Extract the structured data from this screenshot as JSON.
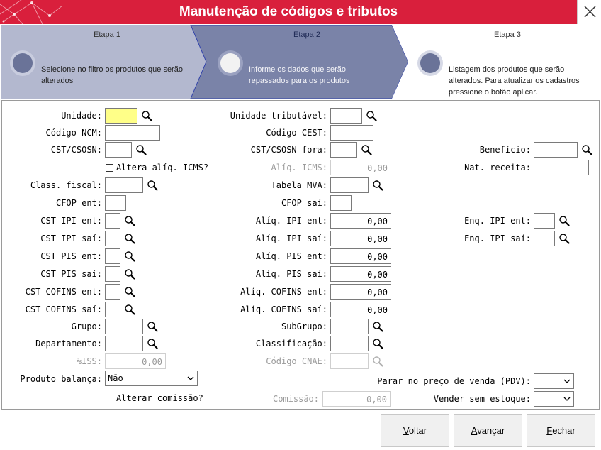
{
  "window": {
    "title": "Manutenção de códigos e tributos"
  },
  "wizard": {
    "steps": [
      {
        "label": "Etapa 1",
        "description": "Selecione no filtro os produtos que serão alterados"
      },
      {
        "label": "Etapa 2",
        "description": "Informe os dados que serão repassados para os produtos"
      },
      {
        "label": "Etapa 3",
        "description": "Listagem dos produtos que serão alterados. Para atualizar os cadastros pressione o botão aplicar."
      }
    ]
  },
  "form": {
    "unidade": "Unidade:",
    "codigo_ncm": "Código NCM:",
    "cst_csosn": "CST/CSOSN:",
    "altera_aliq_icms": "Altera alíq. ICMS?",
    "class_fiscal": "Class. fiscal:",
    "cfop_ent": "CFOP ent:",
    "cst_ipi_ent": "CST IPI ent:",
    "cst_ipi_sai": "CST IPI saí:",
    "cst_pis_ent": "CST PIS ent:",
    "cst_pis_sai": "CST PIS saí:",
    "cst_cofins_ent": "CST COFINS ent:",
    "cst_cofins_sai": "CST COFINS saí:",
    "grupo": "Grupo:",
    "departamento": "Departamento:",
    "iss": "%ISS:",
    "iss_value": "0,00",
    "produto_balanca": "Produto balança:",
    "produto_balanca_value": "Não",
    "alterar_comissao": "Alterar comissão?",
    "unidade_tributavel": "Unidade tributável:",
    "codigo_cest": "Código CEST:",
    "cst_csosn_fora": "CST/CSOSN fora:",
    "aliq_icms": "Alíq. ICMS:",
    "aliq_icms_value": "0,00",
    "tabela_mva": "Tabela MVA:",
    "cfop_sai": "CFOP saí:",
    "aliq_ipi_ent": "Alíq. IPI ent:",
    "aliq_ipi_ent_value": "0,00",
    "aliq_ipi_sai": "Alíq. IPI saí:",
    "aliq_ipi_sai_value": "0,00",
    "aliq_pis_ent": "Alíq. PIS ent:",
    "aliq_pis_ent_value": "0,00",
    "aliq_pis_sai": "Alíq. PIS saí:",
    "aliq_pis_sai_value": "0,00",
    "aliq_cofins_ent": "Alíq. COFINS ent:",
    "aliq_cofins_ent_value": "0,00",
    "aliq_cofins_sai": "Alíq. COFINS saí:",
    "aliq_cofins_sai_value": "0,00",
    "subgrupo": "SubGrupo:",
    "classificacao": "Classificação:",
    "codigo_cnae": "Código CNAE:",
    "parar_preco_venda": "Parar no preço de venda (PDV):",
    "vender_sem_estoque": "Vender sem estoque:",
    "comissao": "Comissão:",
    "comissao_value": "0,00",
    "beneficio": "Benefício:",
    "nat_receita": "Nat. receita:",
    "enq_ipi_ent": "Enq. IPI ent:",
    "enq_ipi_sai": "Enq. IPI saí:"
  },
  "buttons": {
    "voltar": "Voltar",
    "avancar": "Avançar",
    "fechar": "Fechar"
  },
  "colors": {
    "title_bar": "#d91f3c",
    "step1_bg": "#b3b8cf",
    "step2_bg": "#7a83a8",
    "highlight_field": "#ffff88"
  }
}
